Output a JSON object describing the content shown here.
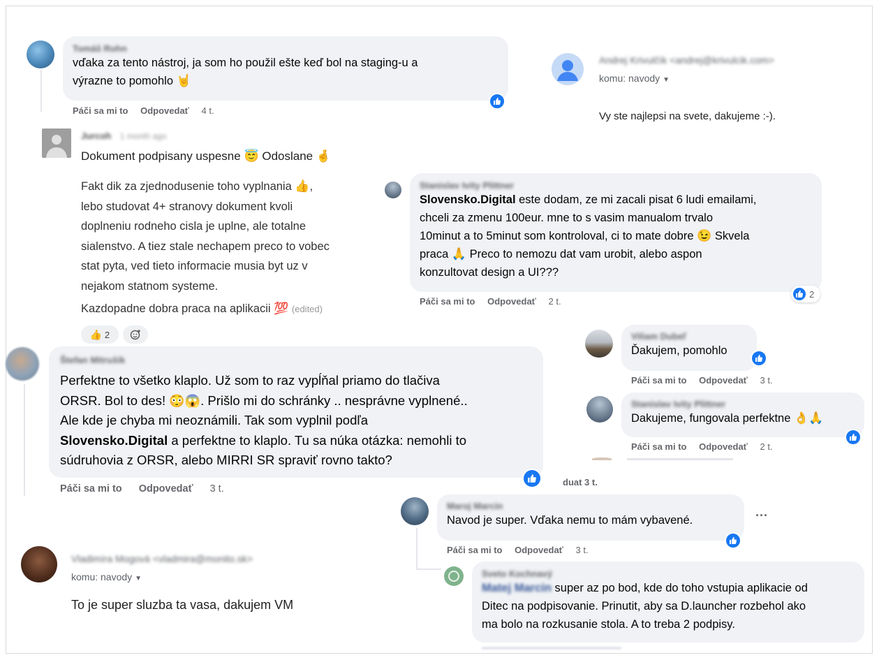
{
  "colors": {
    "bubble": "#f0f2f5",
    "like_blue": "#1877f2",
    "meta_gray": "#65676b",
    "text": "#050505"
  },
  "comments": {
    "c1": {
      "author": "Tomáš Rohn",
      "text_line1": "vďaka za tento nástroj, ja som ho použil ešte keď bol na staging-u a",
      "text_line2": "výrazne to pomohlo",
      "emoji": "🤘",
      "like": "Páči sa mi to",
      "reply": "Odpovedať",
      "time": "4 t."
    },
    "c2": {
      "author": "Jurcoh",
      "time_ago": "1 month ago",
      "line1": "Dokument podpisany uspesne",
      "emoji1": "😇",
      "line1b": "Odoslane",
      "emoji2": "🤞",
      "p1": "Fakt dik za zjednodusenie toho vyplnania",
      "emoji3": "👍",
      "p1_rest": ",",
      "p2": "lebo studovat 4+ stranovy dokument kvoli",
      "p3": "doplneniu rodneho cisla je uplne, ale totalne",
      "p4": "sialenstvo. A tiez stale nechapem preco to vobec",
      "p5": "stat pyta, ved tieto informacie musia byt uz v",
      "p6": "nejakom statnom systeme.",
      "p7": "Kazdopadne dobra praca na aplikacii",
      "emoji4": "💯",
      "edited": "(edited)",
      "reaction_emoji": "👍",
      "reaction_count": "2"
    },
    "c3": {
      "author": "Stanislav Ivity Plittner",
      "mention": "Slovensko.Digital",
      "line1": " este dodam, ze mi zacali pisat 6 ludi emailami,",
      "line2": "chceli za zmenu 100eur. mne to s vasim manualom trvalo",
      "line3": "10minut a to 5minut som kontroloval, ci to mate dobre",
      "emoji1": "😉",
      "line3b": "Skvela",
      "line4": "praca",
      "emoji2": "🙏",
      "line4b": "Preco to nemozu dat vam urobit, alebo aspon",
      "line5": "konzultovat design a UI???",
      "reaction_count": "2",
      "like": "Páči sa mi to",
      "reply": "Odpovedať",
      "time": "2 t."
    },
    "c4": {
      "author": "Viliam Dubeľ",
      "text": "Ďakujem, pomohlo",
      "like": "Páči sa mi to",
      "reply": "Odpovedať",
      "time": "3 t."
    },
    "c5": {
      "author": "Stanislav Ivity Plittner",
      "text": "Dakujeme, fungovala perfektne",
      "emoji": "👌🙏",
      "like": "Páči sa mi to",
      "reply": "Odpovedať",
      "time": "2 t."
    },
    "c6": {
      "author": "Štefan Mitrušík",
      "line1": "Perfektne to všetko klaplo. Už som to raz vypĺňal priamo do tlačiva",
      "line2": "ORSR. Bol to des!",
      "emoji1": "😳😱",
      "line2b": ". Prišlo mi do schránky .. nesprávne vyplnené..",
      "line3": "Ale kde je chyba mi neoznámili. Tak som vyplnil podľa",
      "mention": "Slovensko.Digital",
      "line4b": " a perfektne to klaplo. Tu sa núka otázka: nemohli to",
      "line5": "súdruhovia z ORSR, alebo MIRRI SR spraviť rovno takto?",
      "like": "Páči sa mi to",
      "reply": "Odpovedať",
      "time": "3 t."
    },
    "c7": {
      "author": "Maroj Marcin",
      "text": "Navod je super. Vďaka nemu to mám vybavené.",
      "more": "···",
      "like": "Páči sa mi to",
      "reply": "Odpovedať",
      "time": "3 t."
    },
    "c8": {
      "author": "Sveto Kochnavý",
      "mention": "Matej Marcin",
      "line1": " super az po bod, kde do toho vstupia aplikacie od",
      "line2": "Ditec na podpisovanie. Prinutit, aby sa D.launcher rozbehol ako",
      "line3": "ma bolo na rozkusanie stola. A to treba 2 podpisy."
    }
  },
  "emails": {
    "e1": {
      "sender": "Andrej Krivulčík <andrej@krivulcik.com>",
      "to": "komu: navody",
      "body": "Vy ste najlepsi na svete, dakujeme :-)."
    },
    "e2": {
      "sender": "Vladimíra Mogová <vladmira@monito.sk>",
      "to": "komu: navody",
      "body": "To je super sluzba ta vasa, dakujem VM"
    }
  },
  "partial": {
    "cut_text": "duat   3 t."
  },
  "icons": {
    "like": "thumbs-up-icon",
    "dropdown": "caret-down-icon",
    "add_reaction": "add-reaction-icon",
    "person": "person-icon"
  }
}
